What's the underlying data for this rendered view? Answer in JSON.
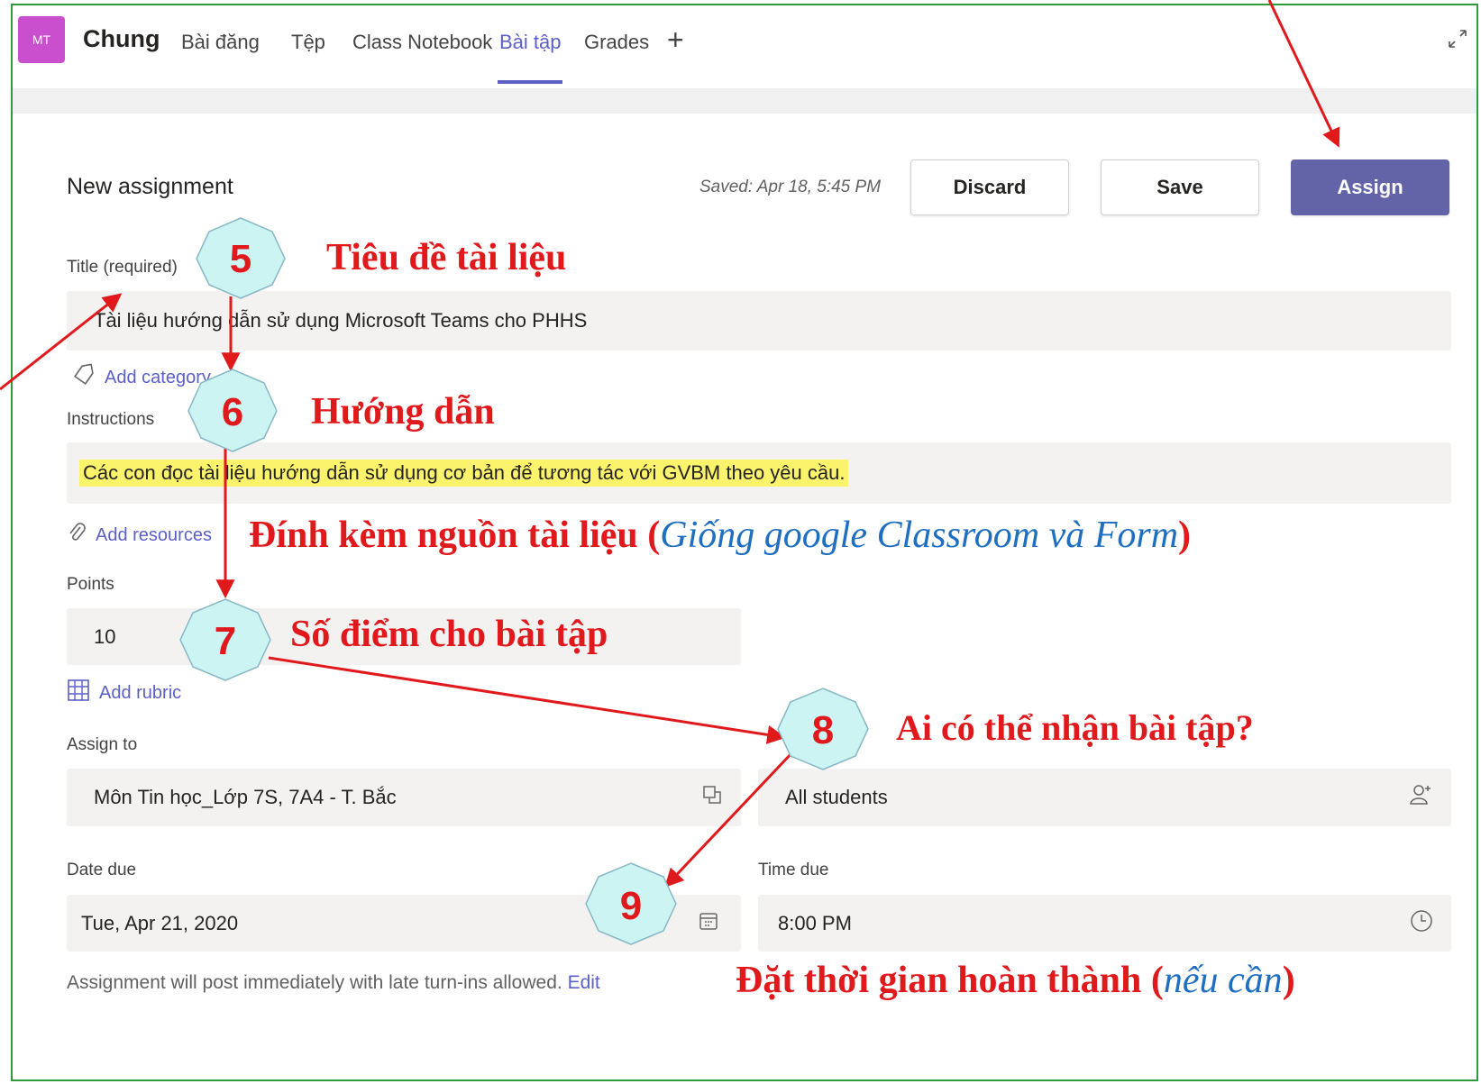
{
  "header": {
    "avatar_initials": "MT",
    "channel_name": "Chung",
    "tabs": [
      "Bài đăng",
      "Tệp",
      "Class Notebook",
      "Bài tập",
      "Grades"
    ],
    "active_tab": "Bài tập",
    "add_tab": "+",
    "expand_icon": "expand-icon"
  },
  "form": {
    "heading": "New assignment",
    "saved_status": "Saved: Apr 18, 5:45 PM",
    "buttons": {
      "discard": "Discard",
      "save": "Save",
      "assign": "Assign"
    },
    "title_label": "Title (required)",
    "title_value": "Tài liệu hướng dẫn sử dụng Microsoft Teams cho PHHS",
    "add_category": "Add category",
    "instructions_label": "Instructions",
    "instructions_value": "Các con đọc tài liệu hướng dẫn sử dụng cơ bản để tương tác với GVBM theo yêu cầu.",
    "add_resources": "Add resources",
    "points_label": "Points",
    "points_value": "10",
    "add_rubric": "Add rubric",
    "assign_to_label": "Assign to",
    "assign_class": "Môn Tin học_Lớp 7S, 7A4 - T. Bắc",
    "assign_students": "All students",
    "date_due_label": "Date due",
    "date_due_value": "Tue, Apr 21, 2020",
    "time_due_label": "Time due",
    "time_due_value": "8:00 PM",
    "footer_note": "Assignment will post immediately with late turn-ins allowed.",
    "footer_edit": "Edit"
  },
  "annotations": {
    "badges": [
      "5",
      "6",
      "7",
      "8",
      "9"
    ],
    "title_note": "Tiêu đề tài liệu",
    "instructions_note": "Hướng dẫn",
    "resources_note_prefix": "Đính kèm nguồn tài liệu (",
    "resources_note_blue": "Giống google Classroom và Form",
    "resources_note_suffix": ")",
    "points_note": "Số điểm cho bài tập",
    "assign_note": "Ai có thể nhận bài tập?",
    "time_note_prefix": "Đặt thời gian hoàn thành  (",
    "time_note_blue": "nếu cần",
    "time_note_suffix": ")"
  },
  "colors": {
    "accent": "#6264a7",
    "annotation_red": "#e0191d",
    "annotation_blue": "#1f6fc1",
    "badge_fill": "#ccf4f2",
    "highlight": "#fbf36c"
  }
}
